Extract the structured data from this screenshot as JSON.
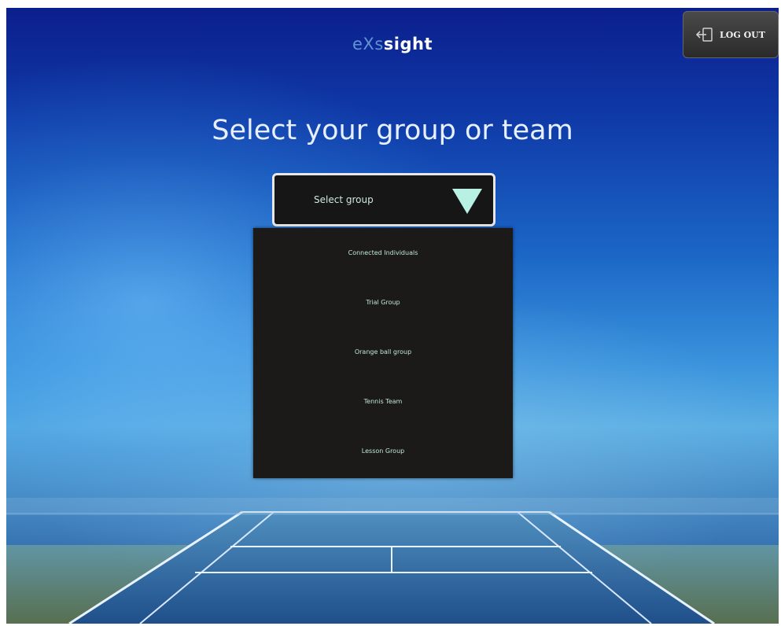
{
  "app": {
    "logo_prefix": "eXs",
    "logo_main": "sight"
  },
  "header": {
    "logout_label": "LOG OUT",
    "logout_icon": "logout-arrow-icon"
  },
  "main": {
    "heading": "Select your group or team",
    "select": {
      "value": "Select group",
      "arrow_icon": "triangle-down-icon"
    },
    "dropdown_options": [
      "Connected Individuals",
      "Trial Group",
      "Orange ball group",
      "Tennis Team",
      "Lesson Group"
    ]
  },
  "colors": {
    "dropdown_bg": "#1b1a19",
    "option_text": "#bfe6dc",
    "arrow": "#b8f0e4",
    "headline": "#e6f0ff"
  }
}
